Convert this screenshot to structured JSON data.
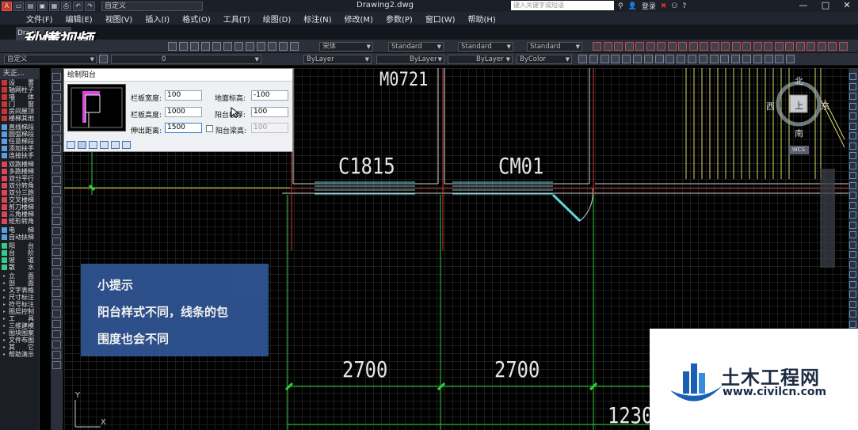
{
  "titlebar": {
    "workspace": "自定义",
    "file_title": "Drawing2.dwg",
    "search_placeholder": "键入关键字或短语",
    "login": "登录",
    "min": "—",
    "max": "□",
    "close": "✕"
  },
  "menu": [
    "文件(F)",
    "编辑(E)",
    "视图(V)",
    "插入(I)",
    "格式(O)",
    "工具(T)",
    "绘图(D)",
    "标注(N)",
    "修改(M)",
    "参数(P)",
    "窗口(W)",
    "帮助(H)"
  ],
  "tabs": {
    "doc": "Draw"
  },
  "logo": {
    "text": "秒懂视频"
  },
  "toolbar": {
    "layer_state": "自定义",
    "layer_value": "0",
    "text_style": "宋体",
    "dim_style": "Standard",
    "table_style": "Standard",
    "ml_style": "Standard",
    "color": "ByLayer",
    "linetype": "ByLayer",
    "lineweight": "ByLayer",
    "plotstyle": "ByColor"
  },
  "left_panel": {
    "header": "天正...",
    "items": [
      {
        "label": "设　　置",
        "color": "#c33"
      },
      {
        "label": "轴网柱子",
        "color": "#c33"
      },
      {
        "label": "墙　　体",
        "color": "#c33"
      },
      {
        "label": "门　　窗",
        "color": "#c33"
      },
      {
        "label": "房间屋顶",
        "color": "#c33"
      },
      {
        "label": "楼梯其他",
        "color": "#c33"
      },
      {
        "label": "直线梯段",
        "color": "#5aa0e0"
      },
      {
        "label": "圆弧梯段",
        "color": "#5aa0e0"
      },
      {
        "label": "任意梯段",
        "color": "#5aa0e0"
      },
      {
        "label": "添加扶手",
        "color": "#5aa0e0"
      },
      {
        "label": "连接扶手",
        "color": "#5aa0e0"
      },
      {
        "label": "双跑楼梯",
        "color": "#d45"
      },
      {
        "label": "多跑楼梯",
        "color": "#d45"
      },
      {
        "label": "双分平行",
        "color": "#d45"
      },
      {
        "label": "双分转角",
        "color": "#d45"
      },
      {
        "label": "双分三跑",
        "color": "#d45"
      },
      {
        "label": "交叉楼梯",
        "color": "#d45"
      },
      {
        "label": "剪刀楼梯",
        "color": "#d45"
      },
      {
        "label": "三角楼梯",
        "color": "#d45"
      },
      {
        "label": "矩形转角",
        "color": "#d45"
      },
      {
        "label": "电　　梯",
        "color": "#5aa0e0"
      },
      {
        "label": "自动扶梯",
        "color": "#5aa0e0"
      },
      {
        "label": "阳　　台",
        "color": "#3c8"
      },
      {
        "label": "台　　阶",
        "color": "#3c8"
      },
      {
        "label": "坡　　道",
        "color": "#3c8"
      },
      {
        "label": "散　　水",
        "color": "#3c8"
      },
      {
        "label": "立　　面",
        "color": ""
      },
      {
        "label": "剖　　面",
        "color": ""
      },
      {
        "label": "文字表格",
        "color": ""
      },
      {
        "label": "尺寸标注",
        "color": ""
      },
      {
        "label": "符号标注",
        "color": ""
      },
      {
        "label": "图层控制",
        "color": ""
      },
      {
        "label": "工　　具",
        "color": ""
      },
      {
        "label": "三维建模",
        "color": ""
      },
      {
        "label": "图块图案",
        "color": ""
      },
      {
        "label": "文件布图",
        "color": ""
      },
      {
        "label": "其　　它",
        "color": ""
      },
      {
        "label": "帮助演示",
        "color": ""
      }
    ]
  },
  "dialog": {
    "title": "绘制阳台",
    "rail_width_label": "栏板宽度:",
    "rail_width": "100",
    "rail_height_label": "栏板高度:",
    "rail_height": "1000",
    "extend_label": "伸出距离:",
    "extend": "1500",
    "ground_label": "地面标高:",
    "ground": "-100",
    "slab_label": "阳台板厚:",
    "slab": "100",
    "beam_label": "阳台梁高:",
    "beam": "100"
  },
  "drawing": {
    "labels": {
      "m": "M0721",
      "c": "C1815",
      "cm": "CM01",
      "d1": "2700",
      "d2": "2700",
      "d3": "1230"
    },
    "compass": {
      "north": "北",
      "south": "南",
      "west": "西",
      "east": "东",
      "center": "上",
      "wcs": "WCS"
    },
    "axis_x": "X",
    "axis_y": "Y"
  },
  "tip": {
    "title": "小提示",
    "line1": "阳台样式不同，线条的包",
    "line2": "围度也会不同"
  },
  "watermark": {
    "name": "土木工程网",
    "url": "www.civilcn.com"
  }
}
